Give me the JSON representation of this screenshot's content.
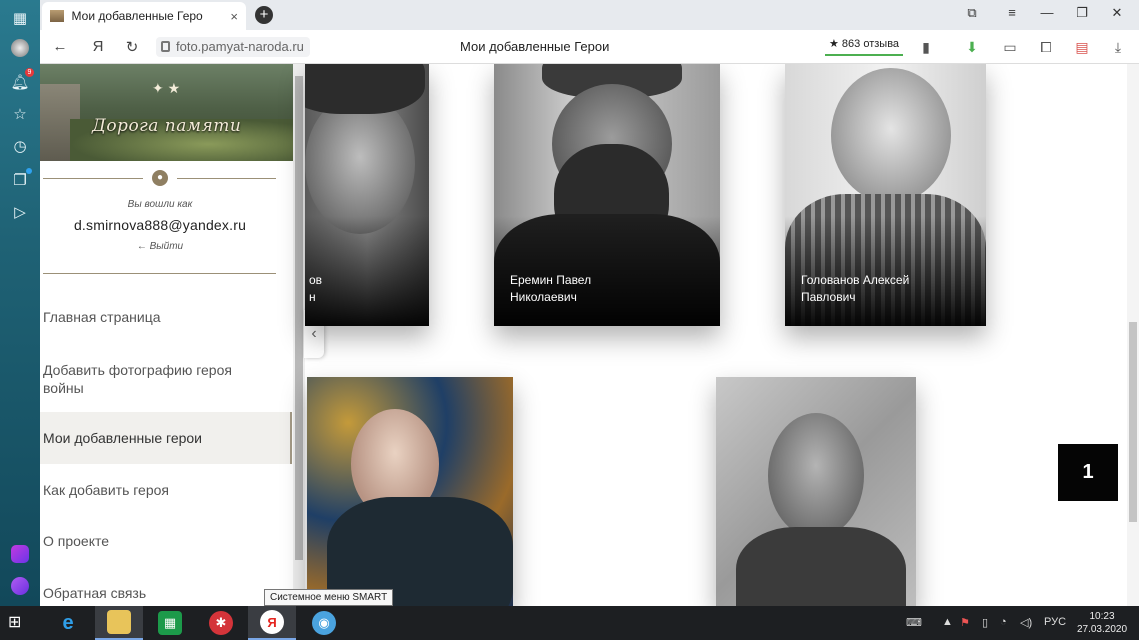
{
  "browser": {
    "tab_title": "Мои добавленные Геро",
    "tab_close": "×",
    "new_tab": "+",
    "url": "foto.pamyat-naroda.ru",
    "page_title": "Мои добавленные Герои",
    "reviews": "★ 863 отзыва",
    "notification_count": "9",
    "yandex_letter": "Я"
  },
  "sidebar": {
    "logo_text": "Дорога памяти",
    "logged_in_label": "Вы вошли как",
    "email": "d.smirnova888@yandex.ru",
    "logout": "← Выйти",
    "menu": [
      {
        "label": "Главная страница"
      },
      {
        "label": "Добавить фотографию героя войны"
      },
      {
        "label": "Мои добавленные герои"
      },
      {
        "label": "Как добавить героя"
      },
      {
        "label": "О проекте"
      },
      {
        "label": "Обратная связь"
      }
    ]
  },
  "heroes": [
    {
      "name_line1": "ов",
      "name_line2": "н"
    },
    {
      "name_line1": "Еремин Павел",
      "name_line2": "Николаевич"
    },
    {
      "name_line1": "Голованов Алексей",
      "name_line2": "Павлович"
    }
  ],
  "tooltip": "Системное меню SMART",
  "up_badge": "1",
  "taskbar": {
    "lang": "РУС",
    "time": "10:23",
    "date": "27.03.2020"
  },
  "colors": {
    "rail": "#1f6275",
    "active_menu_bg": "#f1f0ed",
    "divider": "#9b9077",
    "taskbar": "#1d1f22"
  }
}
